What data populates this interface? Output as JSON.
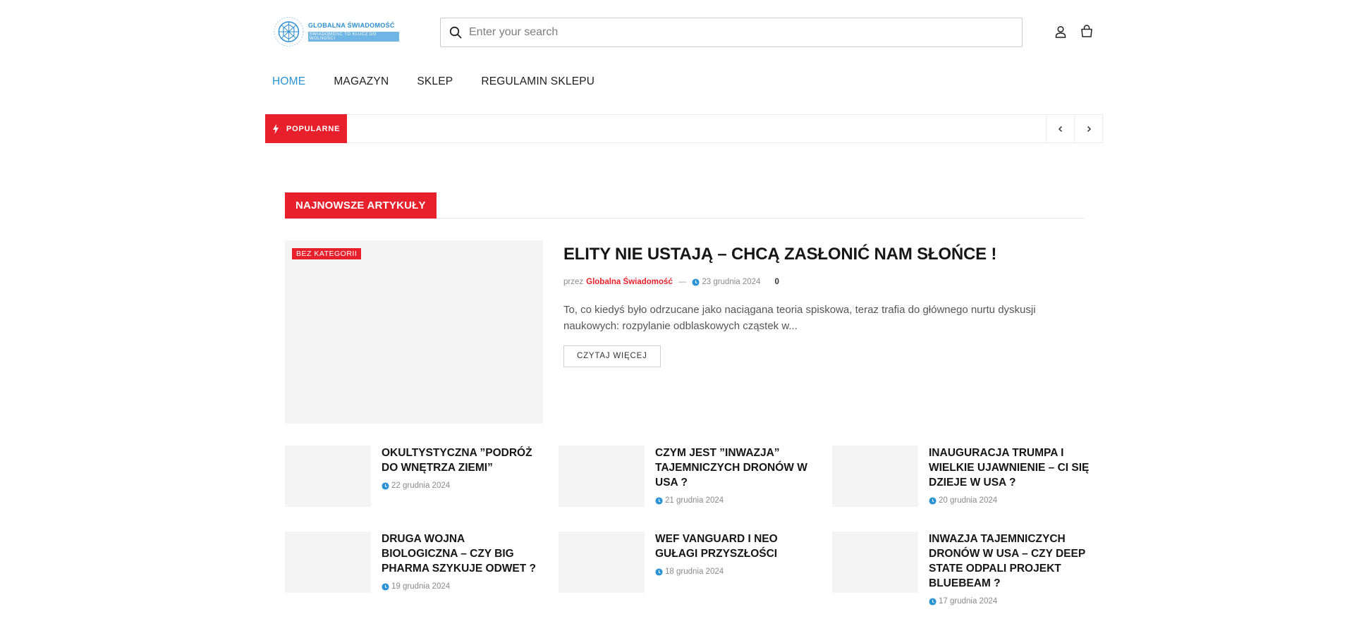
{
  "brand": {
    "name": "GLOBALNA ŚWIADOMOŚĆ",
    "tagline": "ŚWIADOMOŚĆ TO KLUCZ DO WOLNOŚCI"
  },
  "search": {
    "placeholder": "Enter your search",
    "value": ""
  },
  "nav": {
    "items": [
      {
        "label": "HOME",
        "active": true
      },
      {
        "label": "MAGAZYN",
        "active": false
      },
      {
        "label": "SKLEP",
        "active": false
      },
      {
        "label": "REGULAMIN SKLEPU",
        "active": false
      }
    ]
  },
  "ticker": {
    "label": "POPULARNE"
  },
  "section": {
    "title": "NAJNOWSZE ARTYKUŁY"
  },
  "featured": {
    "category": "BEZ KATEGORII",
    "title": "ELITY NIE USTAJĄ – CHCĄ ZASŁONIĆ NAM SŁOŃCE !",
    "by": "przez",
    "author": "Globalna Świadomość",
    "sep": "—",
    "date": "23 grudnia 2024",
    "comments": "0",
    "excerpt": "To, co kiedyś było odrzucane jako naciągana teoria spiskowa, teraz trafia do głównego nurtu dyskusji naukowych: rozpylanie odblaskowych cząstek w...",
    "read_more": "CZYTAJ WIĘCEJ"
  },
  "posts": [
    {
      "title": "OKULTYSTYCZNA ”PODRÓŻ DO WNĘTRZA ZIEMI”",
      "date": "22 grudnia 2024"
    },
    {
      "title": "CZYM JEST ”INWAZJA” TAJEMNICZYCH DRONÓW W USA ?",
      "date": "21 grudnia 2024"
    },
    {
      "title": "INAUGURACJA TRUMPA I WIELKIE UJAWNIENIE – CI SIĘ DZIEJE W USA ?",
      "date": "20 grudnia 2024"
    },
    {
      "title": "DRUGA WOJNA BIOLOGICZNA – CZY BIG PHARMA SZYKUJE ODWET ?",
      "date": "19 grudnia 2024"
    },
    {
      "title": "WEF VANGUARD I NEO GUŁAGI PRZYSZŁOŚCI",
      "date": "18 grudnia 2024"
    },
    {
      "title": "INWAZJA TAJEMNICZYCH DRONÓW W USA – CZY DEEP STATE ODPALI PROJEKT BLUEBEAM ?",
      "date": "17 grudnia 2024"
    }
  ],
  "colors": {
    "accent_red": "#e8202b",
    "accent_blue": "#2a93d5"
  }
}
